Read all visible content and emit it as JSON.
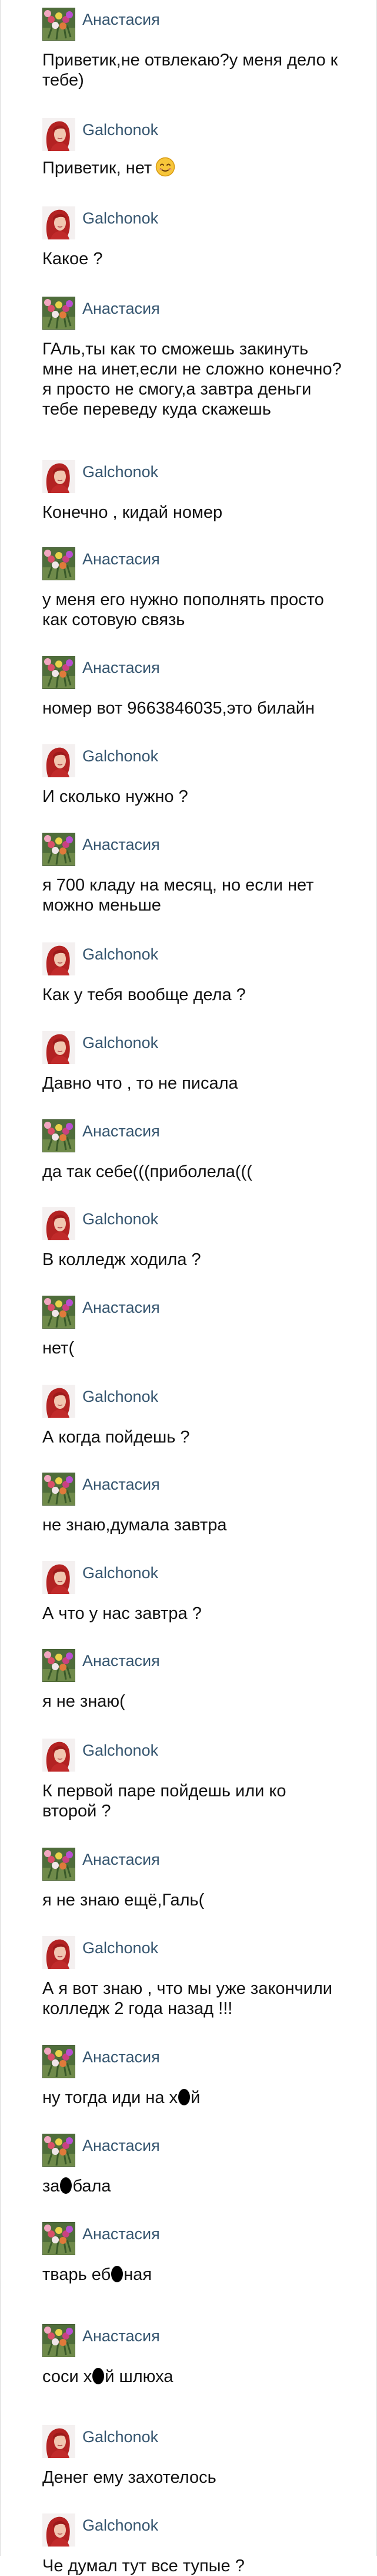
{
  "conversation": {
    "participants": {
      "anastasia": "Анастасия",
      "galchonok": "Galchonok"
    },
    "messages": [
      {
        "sender": "anastasia",
        "text": "Приветик,не отвлекаю?у меня дело к тебе)"
      },
      {
        "sender": "galchonok",
        "text": "Приветик, нет",
        "emoji": "smiling-face-emoji"
      },
      {
        "sender": "galchonok",
        "text": "Какое ?"
      },
      {
        "sender": "anastasia",
        "text": "ГАль,ты как то сможешь закинуть мне на инет,если не сложно конечно?я просто не смогу,а завтра деньги тебе переведу куда скажешь"
      },
      {
        "sender": "galchonok",
        "text": "Конечно , кидай номер"
      },
      {
        "sender": "anastasia",
        "text": "у меня его нужно пополнять просто как сотовую связь"
      },
      {
        "sender": "anastasia",
        "text": "номер вот 9663846035,это билайн"
      },
      {
        "sender": "galchonok",
        "text": "И сколько нужно ?"
      },
      {
        "sender": "anastasia",
        "text": "я 700 кладу на месяц, но если нет можно меньше"
      },
      {
        "sender": "galchonok",
        "text": "Как у тебя вообще дела ?"
      },
      {
        "sender": "galchonok",
        "text": "Давно что , то не писала"
      },
      {
        "sender": "anastasia",
        "text": "да так себе(((приболела((("
      },
      {
        "sender": "galchonok",
        "text": "В колледж ходила ?"
      },
      {
        "sender": "anastasia",
        "text": "нет("
      },
      {
        "sender": "galchonok",
        "text": "А когда пойдешь ?"
      },
      {
        "sender": "anastasia",
        "text": "не знаю,думала завтра"
      },
      {
        "sender": "galchonok",
        "text": "А что у нас завтра ?"
      },
      {
        "sender": "anastasia",
        "text": "я не знаю("
      },
      {
        "sender": "galchonok",
        "text": "К первой паре пойдешь или ко второй ?"
      },
      {
        "sender": "anastasia",
        "text": "я не знаю ещё,Галь("
      },
      {
        "sender": "galchonok",
        "text": "А я вот знаю , что мы уже закончили колледж 2 года назад !!!"
      },
      {
        "sender": "anastasia",
        "parts": [
          "ну тогда иди на х",
          "censor",
          "й"
        ]
      },
      {
        "sender": "anastasia",
        "parts": [
          "за",
          "censor",
          "бала"
        ]
      },
      {
        "sender": "anastasia",
        "parts": [
          "тварь еб",
          "censor",
          "ная"
        ]
      },
      {
        "sender": "anastasia",
        "parts": [
          "соси х",
          "censor",
          "й шлюха"
        ]
      },
      {
        "sender": "galchonok",
        "text": "Денег ему захотелось"
      },
      {
        "sender": "galchonok",
        "text": "Че думал тут все тупые ?"
      }
    ]
  },
  "colors": {
    "sender_name": "#35556f",
    "message_text": "#111111",
    "background": "#ffffff",
    "censor_mark": "#000000"
  },
  "avatars": {
    "anastasia": "flower-bouquet-avatar",
    "galchonok": "red-haired-woman-avatar"
  }
}
